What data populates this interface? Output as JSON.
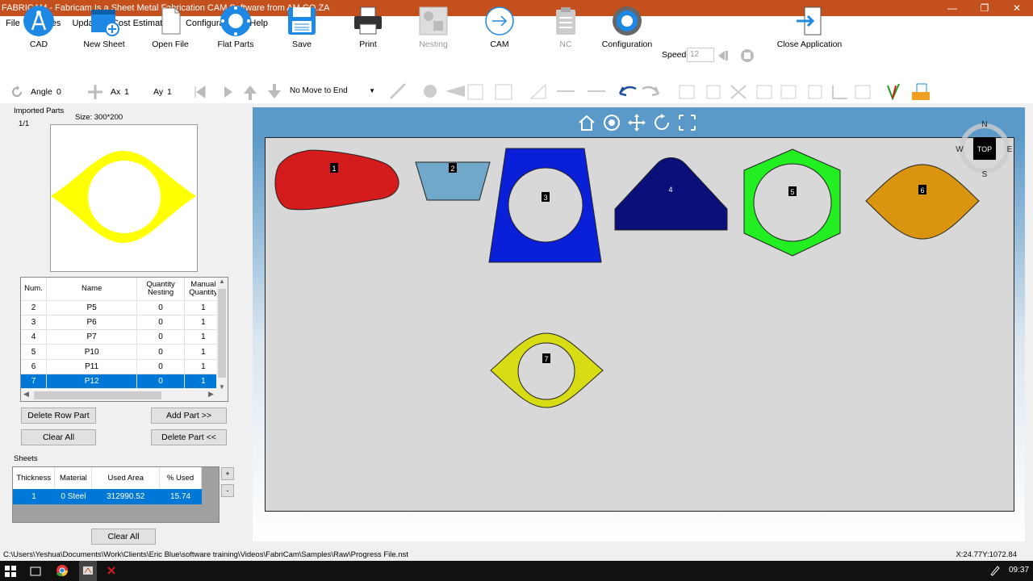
{
  "window": {
    "title": "FABRICAM - Fabricam Is a Sheet Metal Fabrication CAM Software from AM.CO.ZA",
    "minimize": "—",
    "restore": "❐",
    "close": "✕"
  },
  "menu": [
    "File",
    "Phases",
    "Update",
    "Cost Estimation",
    "Configuration",
    "Help"
  ],
  "ribbon": [
    {
      "label": "CAD",
      "icon": "compass-icon"
    },
    {
      "label": "New Sheet",
      "icon": "new-sheet-icon"
    },
    {
      "label": "Open File",
      "icon": "file-icon"
    },
    {
      "label": "Flat Parts",
      "icon": "flat-parts-icon"
    },
    {
      "label": "Save",
      "icon": "floppy-icon"
    },
    {
      "label": "Print",
      "icon": "printer-icon"
    },
    {
      "label": "Nesting",
      "icon": "nesting-icon"
    },
    {
      "label": "CAM",
      "icon": "arrow-circle-icon"
    },
    {
      "label": "NC",
      "icon": "clipboard-icon"
    },
    {
      "label": "Configuration",
      "icon": "gear-icon"
    },
    {
      "label": "Close Application",
      "icon": "exit-icon"
    }
  ],
  "speed": {
    "label": "Speed",
    "value": "12"
  },
  "toolbar2": {
    "angle_label": "Angle",
    "angle_value": "0",
    "ax_label": "Ax",
    "ax_value": "1",
    "ay_label": "Ay",
    "ay_value": "1",
    "move_option": "No Move to End"
  },
  "imported_parts": {
    "title": "Imported Parts",
    "page": "1/1",
    "size": "Size: 300*200",
    "columns": [
      "Num.",
      "Name",
      "Quantity Nesting",
      "Manual Quantity"
    ],
    "rows": [
      {
        "num": "2",
        "name": "P5",
        "qn": "0",
        "mq": "1"
      },
      {
        "num": "3",
        "name": "P6",
        "qn": "0",
        "mq": "1"
      },
      {
        "num": "4",
        "name": "P7",
        "qn": "0",
        "mq": "1"
      },
      {
        "num": "5",
        "name": "P10",
        "qn": "0",
        "mq": "1"
      },
      {
        "num": "6",
        "name": "P11",
        "qn": "0",
        "mq": "1"
      },
      {
        "num": "7",
        "name": "P12",
        "qn": "0",
        "mq": "1"
      }
    ],
    "selected_row": 5,
    "buttons": {
      "delete_row": "Delete Row Part",
      "add_part": "Add Part >>",
      "clear_all": "Clear All",
      "delete_part": "Delete Part <<"
    }
  },
  "sheets": {
    "title": "Sheets",
    "columns": [
      "Thickness",
      "Material",
      "Used Area",
      "% Used"
    ],
    "rows": [
      {
        "thickness": "1",
        "material_idx": "0",
        "material": "Steel",
        "used_area": "312990.52",
        "pct": "15.74"
      }
    ],
    "plus": "+",
    "minus": "-",
    "clear_all": "Clear All"
  },
  "parts_on_sheet": [
    "1",
    "2",
    "3",
    "4",
    "5",
    "6",
    "7"
  ],
  "part_colors": {
    "p1": "#d41c1c",
    "p2": "#6fa8c8",
    "p3": "#0a1fd8",
    "p4": "#0a0f7a",
    "p5": "#22ee22",
    "p6": "#d99410",
    "p7": "#d8dc14",
    "preview": "#ffff00"
  },
  "compass": {
    "n": "N",
    "s": "S",
    "e": "E",
    "w": "W",
    "top": "TOP"
  },
  "status": {
    "path": "C:\\Users\\Yeshua\\Documents\\Work\\Clients\\Eric Blue\\software training\\Videos\\FabriCam\\Samples\\Raw\\Progress File.nst",
    "coords": "X:24.77Y:1072.84"
  },
  "taskbar": {
    "time": "09:37"
  }
}
